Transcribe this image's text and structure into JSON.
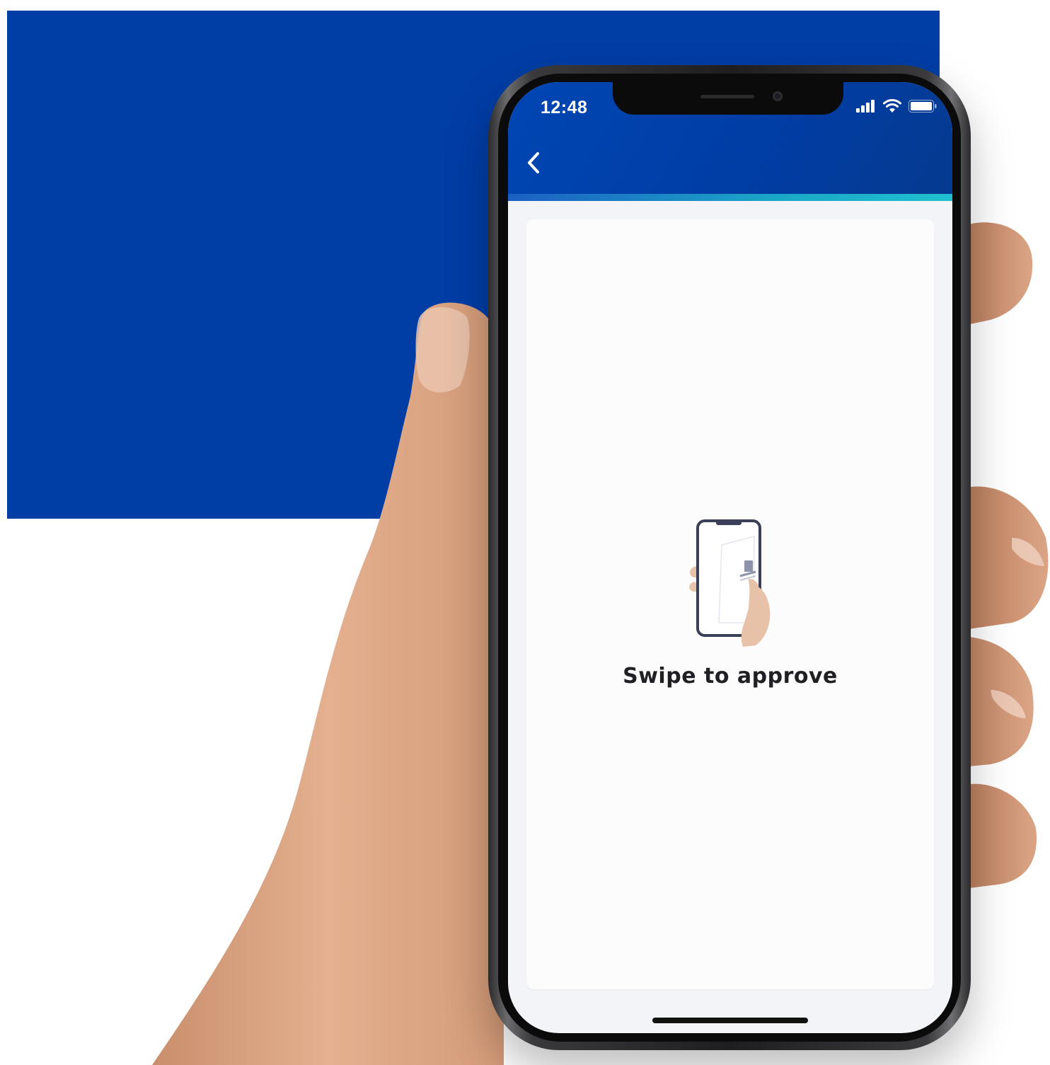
{
  "status_bar": {
    "time": "12:48"
  },
  "header": {
    "back_icon": "chevron-left-icon"
  },
  "content": {
    "illustration_icon": "phone-in-hand-icon",
    "message": "Swipe to approve"
  },
  "colors": {
    "brand_blue": "#003da5",
    "accent_teal": "#20c0cf",
    "screen_background": "#f2f4f7",
    "card_background": "#fcfcfd",
    "text_primary": "#1f1f24"
  }
}
